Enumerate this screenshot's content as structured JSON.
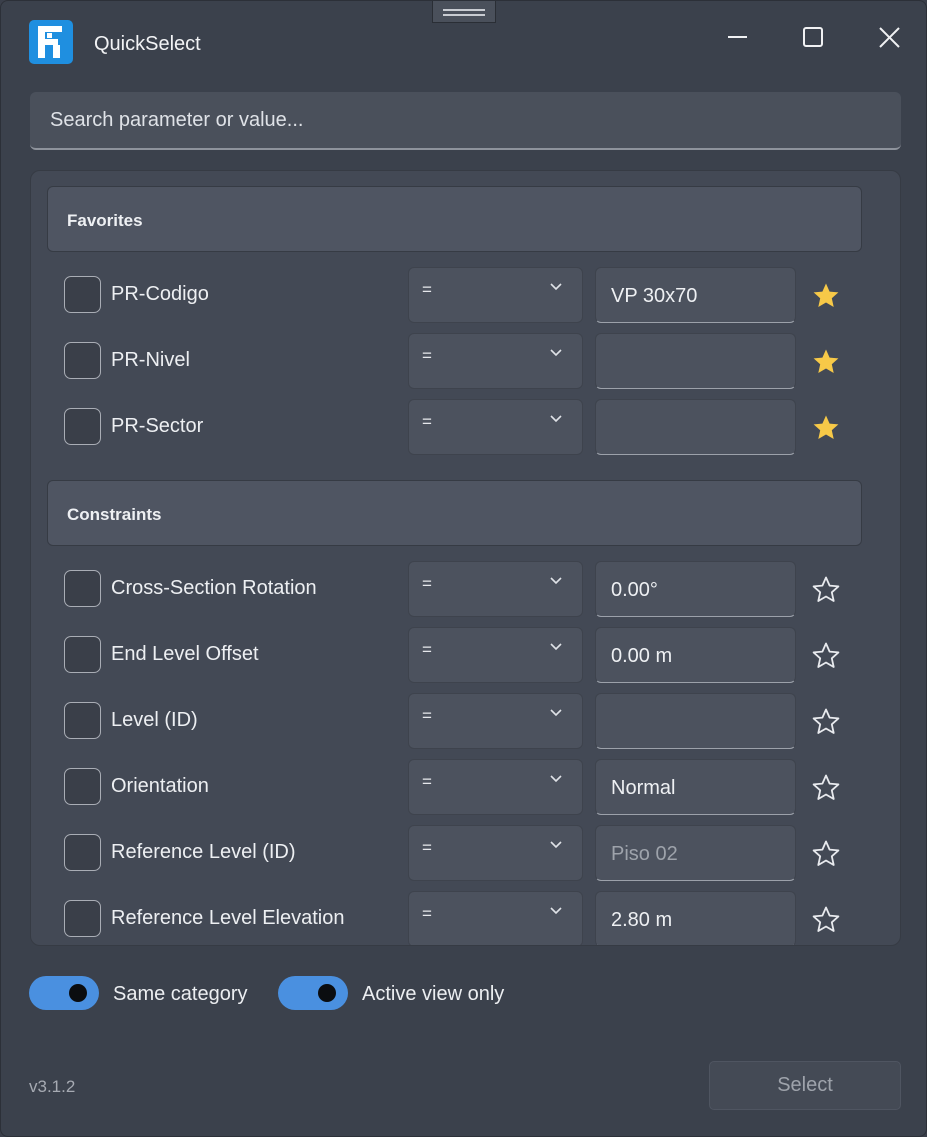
{
  "app": {
    "title": "QuickSelect",
    "version": "v3.1.2"
  },
  "search": {
    "placeholder": "Search parameter or value..."
  },
  "sections": {
    "favorites": {
      "title": "Favorites"
    },
    "constraints": {
      "title": "Constraints"
    }
  },
  "favorites": [
    {
      "label": "PR-Codigo",
      "operator": "=",
      "value": "VP 30x70",
      "favorite": true,
      "checked": false
    },
    {
      "label": "PR-Nivel",
      "operator": "=",
      "value": "",
      "favorite": true,
      "checked": false
    },
    {
      "label": "PR-Sector",
      "operator": "=",
      "value": "",
      "favorite": true,
      "checked": false
    }
  ],
  "constraints": [
    {
      "label": "Cross-Section Rotation",
      "operator": "=",
      "value": "0.00°",
      "favorite": false,
      "checked": false
    },
    {
      "label": "End Level Offset",
      "operator": "=",
      "value": "0.00 m",
      "favorite": false,
      "checked": false
    },
    {
      "label": "Level  (ID)",
      "operator": "=",
      "value": "",
      "favorite": false,
      "checked": false
    },
    {
      "label": "Orientation",
      "operator": "=",
      "value": "Normal",
      "favorite": false,
      "checked": false
    },
    {
      "label": "Reference Level  (ID)",
      "operator": "=",
      "value": "Piso 02",
      "favorite": false,
      "checked": false,
      "disabled": true
    },
    {
      "label": "Reference Level Elevation",
      "operator": "=",
      "value": "2.80 m",
      "favorite": false,
      "checked": false
    }
  ],
  "toggles": {
    "same_category": {
      "label": "Same category",
      "on": true
    },
    "active_view": {
      "label": "Active view only",
      "on": true
    }
  },
  "actions": {
    "select_label": "Select"
  },
  "colors": {
    "accent": "#4a90e0",
    "star": "#f7c948",
    "logo": "#1f8fe0"
  },
  "icons": {
    "favorite_on": "star-filled-icon",
    "favorite_off": "star-outline-icon",
    "dropdown": "chevron-down-icon"
  }
}
